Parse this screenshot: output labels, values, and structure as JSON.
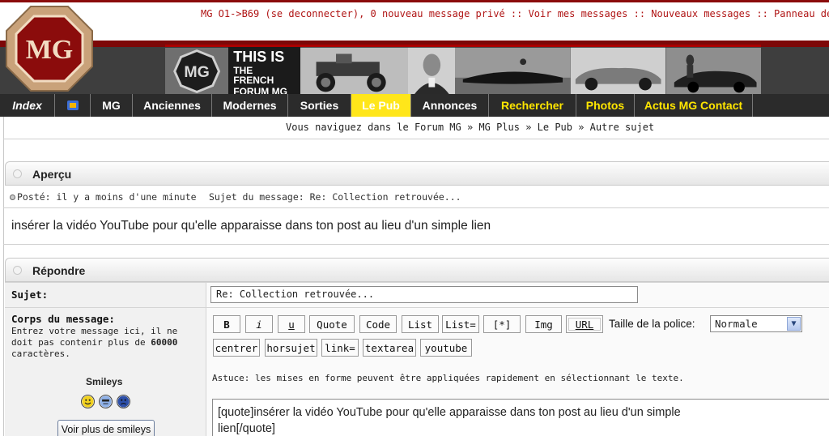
{
  "header": {
    "top_links": "MG O1->B69 (se deconnecter), 0 nouveau message privé :: Voir mes messages :: Nouveaux messages :: Panneau de",
    "logo_text": "MG",
    "banner": {
      "line1": "THIS IS",
      "line2": "THE FRENCH",
      "line3": "FORUM MG"
    }
  },
  "nav": {
    "items": [
      {
        "label": "Index",
        "style": "index"
      },
      {
        "label": "",
        "style": "icon"
      },
      {
        "label": "MG",
        "style": "normal"
      },
      {
        "label": "Anciennes",
        "style": "normal"
      },
      {
        "label": "Modernes",
        "style": "normal"
      },
      {
        "label": "Sorties",
        "style": "normal"
      },
      {
        "label": "Le Pub",
        "style": "active"
      },
      {
        "label": "Annonces",
        "style": "normal"
      },
      {
        "label": "Rechercher",
        "style": "yellow"
      },
      {
        "label": "Photos",
        "style": "yellow"
      },
      {
        "label": "Actus MG Contact",
        "style": "yellow"
      }
    ]
  },
  "breadcrumb": "Vous naviguez dans le Forum MG » MG Plus » Le Pub » Autre sujet",
  "preview": {
    "title": "Aperçu",
    "posted": "Posté: il y a moins d'une minute",
    "subject": "Sujet du message: Re: Collection retrouvée...",
    "text": "insérer la vidéo YouTube pour qu'elle apparaisse dans ton post au lieu d'un simple lien"
  },
  "reply": {
    "title": "Répondre",
    "subject_label": "Sujet:",
    "subject_value": "Re: Collection retrouvée...",
    "body_label": "Corps du message:",
    "hint_prefix": "Entrez votre message ici, il ne doit pas contenir plus de",
    "hint_limit": "60000",
    "hint_suffix": "caractères.",
    "format_buttons": [
      "B",
      "i",
      "u",
      "Quote",
      "Code",
      "List",
      "List=",
      "[*]",
      "Img",
      "URL"
    ],
    "format_buttons_row2": [
      "centrer",
      "horsujet",
      "link=",
      "textarea",
      "youtube"
    ],
    "font_size_label": "Taille de la police:",
    "font_size_value": "Normale",
    "astuce": "Astuce: les mises en forme peuvent être appliquées rapidement en sélectionnant le texte.",
    "smileys_title": "Smileys",
    "more_smileys": "Voir plus de smileys",
    "message_line1": "[quote]insérer la vidéo YouTube pour qu'elle apparaisse dans ton post au lieu d'un simple",
    "message_line2": "lien[/quote]"
  },
  "colors": {
    "brand_red": "#8b0c0c",
    "nav_bg": "#2b2b2b",
    "nav_active": "#ffe61a",
    "link_red": "#b01515"
  }
}
